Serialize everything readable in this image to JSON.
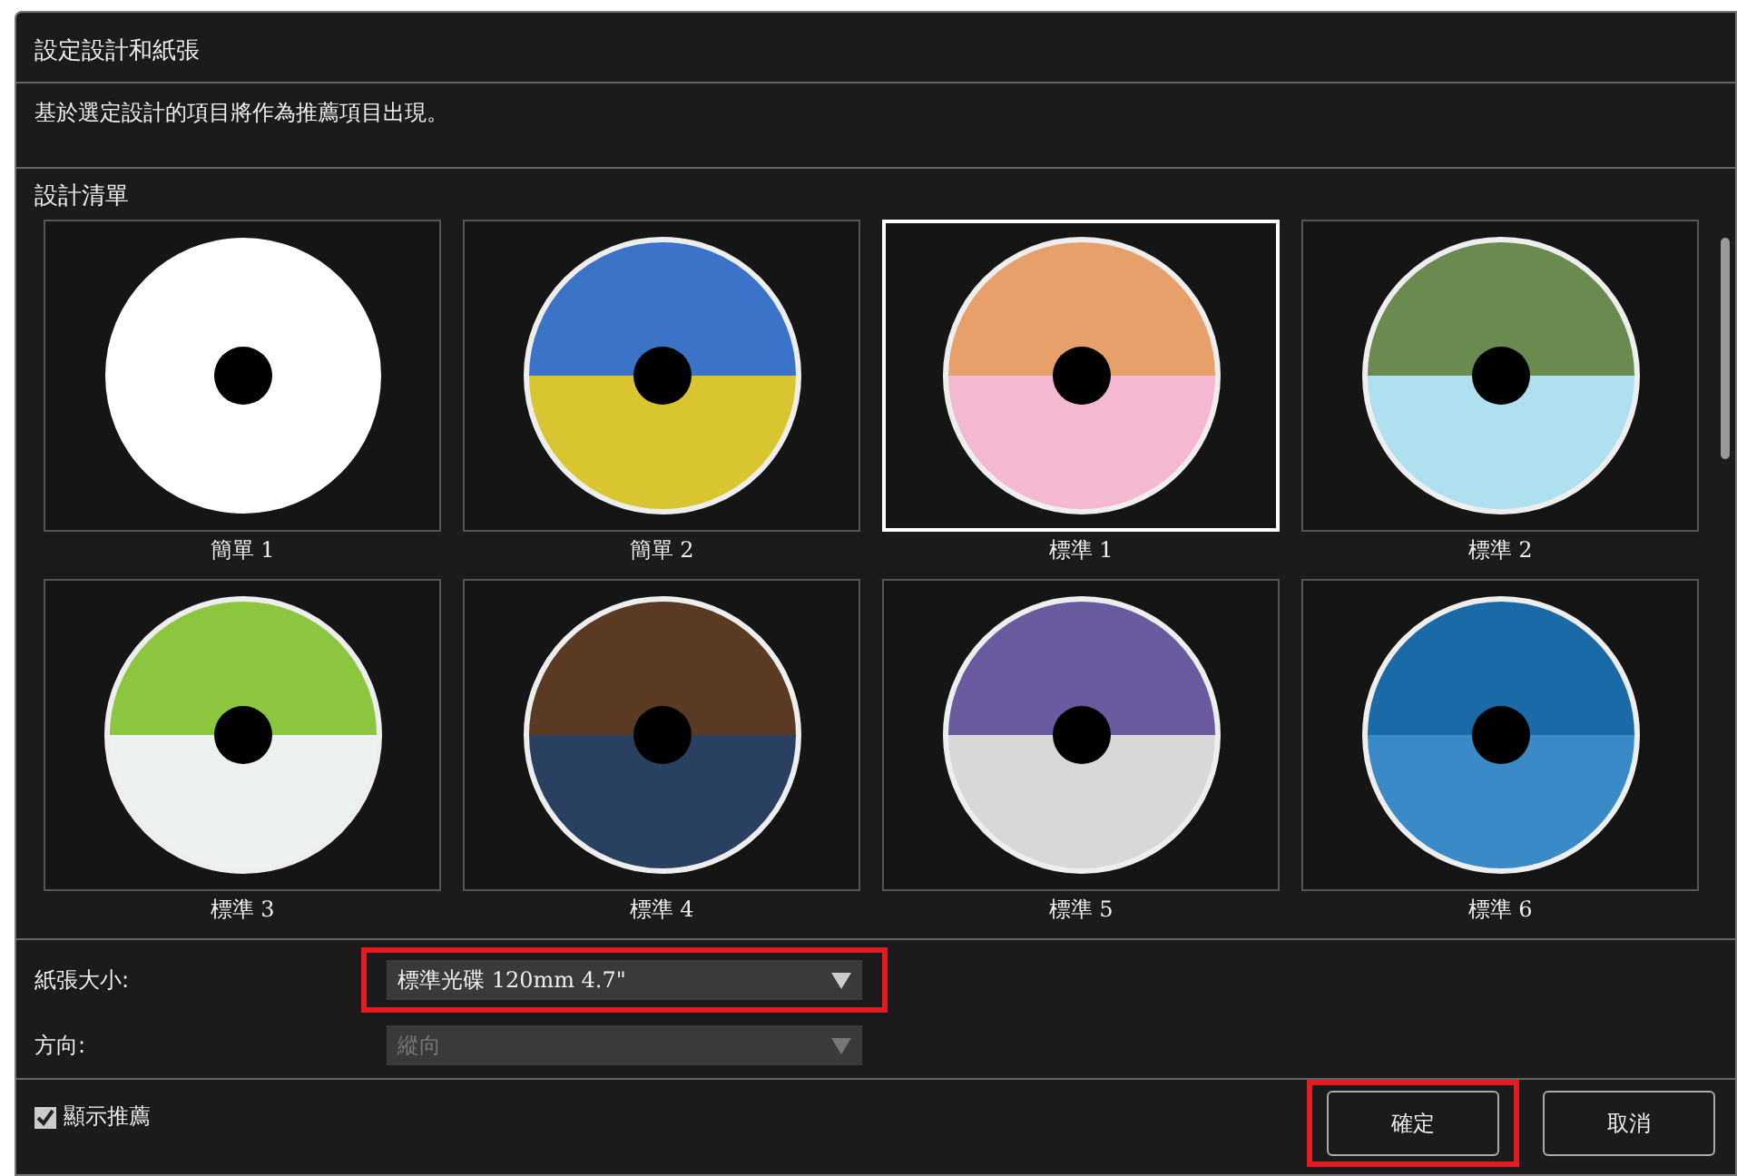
{
  "window": {
    "title": "設定設計和紙張"
  },
  "description": "基於選定設計的項目將作為推薦項目出現。",
  "design_list": {
    "heading": "設計清單",
    "items": [
      {
        "label": "簡單 1",
        "selected": false,
        "kind": "plain"
      },
      {
        "label": "簡單 2",
        "selected": false,
        "kind": "photo"
      },
      {
        "label": "標準 1",
        "selected": true,
        "kind": "photo"
      },
      {
        "label": "標準 2",
        "selected": false,
        "kind": "photo"
      },
      {
        "label": "標準 3",
        "selected": false,
        "kind": "photo"
      },
      {
        "label": "標準 4",
        "selected": false,
        "kind": "photo"
      },
      {
        "label": "標準 5",
        "selected": false,
        "kind": "photo"
      },
      {
        "label": "標準 6",
        "selected": false,
        "kind": "photo"
      }
    ]
  },
  "settings": [
    {
      "label": "紙張大小:",
      "value": "標準光碟 120mm 4.7\"",
      "disabled": false,
      "highlighted": true
    },
    {
      "label": "方向:",
      "value": "縱向",
      "disabled": true,
      "highlighted": false
    }
  ],
  "show_recommended": {
    "label": "顯示推薦",
    "checked": true
  },
  "buttons": [
    {
      "label": "確定",
      "highlighted": true
    },
    {
      "label": "取消",
      "highlighted": false
    }
  ]
}
